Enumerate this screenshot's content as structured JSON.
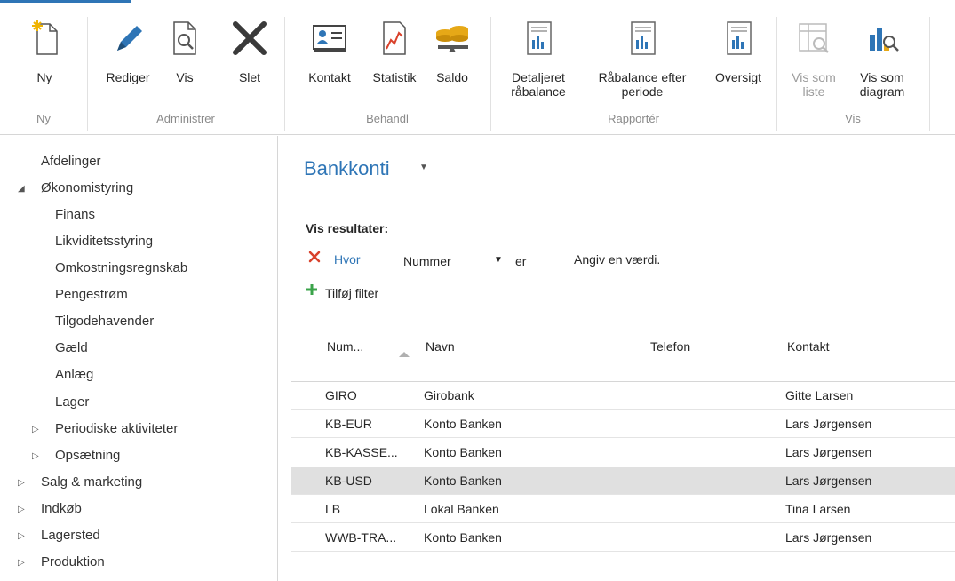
{
  "ribbon": {
    "groups": [
      {
        "label": "Ny",
        "buttons": [
          {
            "label": "Ny",
            "icon": "new-document-icon"
          }
        ]
      },
      {
        "label": "Administrer",
        "buttons": [
          {
            "label": "Rediger",
            "icon": "pencil-icon"
          },
          {
            "label": "Vis",
            "icon": "view-document-icon"
          },
          {
            "label": "Slet",
            "icon": "delete-x-icon"
          }
        ]
      },
      {
        "label": "Behandl",
        "buttons": [
          {
            "label": "Kontakt",
            "icon": "contact-card-icon"
          },
          {
            "label": "Statistik",
            "icon": "statistics-chart-icon"
          },
          {
            "label": "Saldo",
            "icon": "coins-balance-icon"
          }
        ]
      },
      {
        "label": "Rapportér",
        "buttons": [
          {
            "label": "Detaljeret råbalance",
            "icon": "report-icon"
          },
          {
            "label": "Råbalance efter periode",
            "icon": "report-icon"
          },
          {
            "label": "Oversigt",
            "icon": "report-icon"
          }
        ]
      },
      {
        "label": "Vis",
        "buttons": [
          {
            "label": "Vis som liste",
            "icon": "list-view-icon",
            "disabled": true
          },
          {
            "label": "Vis som diagram",
            "icon": "chart-view-icon"
          }
        ]
      }
    ]
  },
  "sidebar": {
    "items": [
      {
        "label": "Afdelinger"
      },
      {
        "label": "Økonomistyring",
        "expanded": true
      },
      {
        "label": "Finans"
      },
      {
        "label": "Likviditetsstyring"
      },
      {
        "label": "Omkostningsregnskab"
      },
      {
        "label": "Pengestrøm"
      },
      {
        "label": "Tilgodehavender"
      },
      {
        "label": "Gæld"
      },
      {
        "label": "Anlæg"
      },
      {
        "label": "Lager"
      },
      {
        "label": "Periodiske aktiviteter",
        "expandable": true
      },
      {
        "label": "Opsætning",
        "expandable": true
      },
      {
        "label": "Salg & marketing",
        "expandable": true
      },
      {
        "label": "Indkøb",
        "expandable": true
      },
      {
        "label": "Lagersted",
        "expandable": true
      },
      {
        "label": "Produktion",
        "expandable": true
      }
    ]
  },
  "main": {
    "title": "Bankkonti",
    "results_label": "Vis resultater:",
    "filter": {
      "where": "Hvor",
      "field": "Nummer",
      "operator": "er",
      "value_placeholder": "Angiv en værdi."
    },
    "add_filter": "Tilføj filter",
    "columns": [
      "Num...",
      "Navn",
      "Telefon",
      "Kontakt"
    ],
    "rows": [
      {
        "nummer": "GIRO",
        "navn": "Girobank",
        "telefon": "",
        "kontakt": "Gitte Larsen"
      },
      {
        "nummer": "KB-EUR",
        "navn": "Konto Banken",
        "telefon": "",
        "kontakt": "Lars Jørgensen"
      },
      {
        "nummer": "KB-KASSE...",
        "navn": "Konto Banken",
        "telefon": "",
        "kontakt": "Lars Jørgensen"
      },
      {
        "nummer": "KB-USD",
        "navn": "Konto Banken",
        "telefon": "",
        "kontakt": "Lars Jørgensen",
        "selected": true
      },
      {
        "nummer": "LB",
        "navn": "Lokal Banken",
        "telefon": "",
        "kontakt": "Tina Larsen"
      },
      {
        "nummer": "WWB-TRA...",
        "navn": "Konto Banken",
        "telefon": "",
        "kontakt": "Lars Jørgensen"
      }
    ]
  },
  "colors": {
    "accent": "#2e75b6",
    "delete_red": "#d9412b",
    "add_green": "#3aa34a",
    "selected_row": "#e0e0e0"
  }
}
